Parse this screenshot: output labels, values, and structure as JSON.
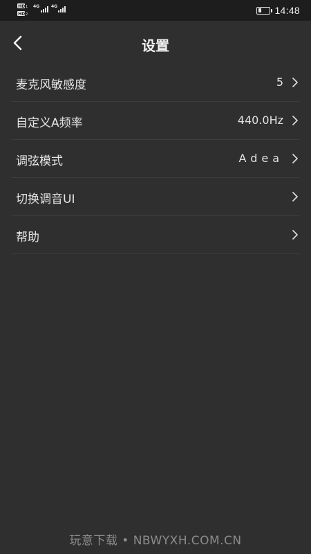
{
  "status_bar": {
    "left_badges": [
      "HD",
      "4G",
      "HD",
      "4G"
    ],
    "battery_level": 0.3,
    "time": "14:48"
  },
  "header": {
    "back_icon": "chevron-left-icon",
    "title": "设置"
  },
  "settings": {
    "items": [
      {
        "label": "麦克风敏感度",
        "value": "5",
        "icon": "chevron-right-icon"
      },
      {
        "label": "自定义A频率",
        "value": "440.0Hz",
        "icon": "chevron-right-icon"
      },
      {
        "label": "调弦模式",
        "value": "Adea",
        "icon": "chevron-right-icon"
      },
      {
        "label": "切换调音UI",
        "value": "",
        "icon": "chevron-right-icon"
      },
      {
        "label": "帮助",
        "value": "",
        "icon": "chevron-right-icon"
      }
    ]
  },
  "watermark": "玩意下载 • NBWYXH.COM.CN",
  "colors": {
    "background": "#2f2f2f",
    "status_bar": "#1d1d1d",
    "divider": "#3c3c3c",
    "text": "#e6e6e6",
    "watermark": "#8c8c8c"
  }
}
